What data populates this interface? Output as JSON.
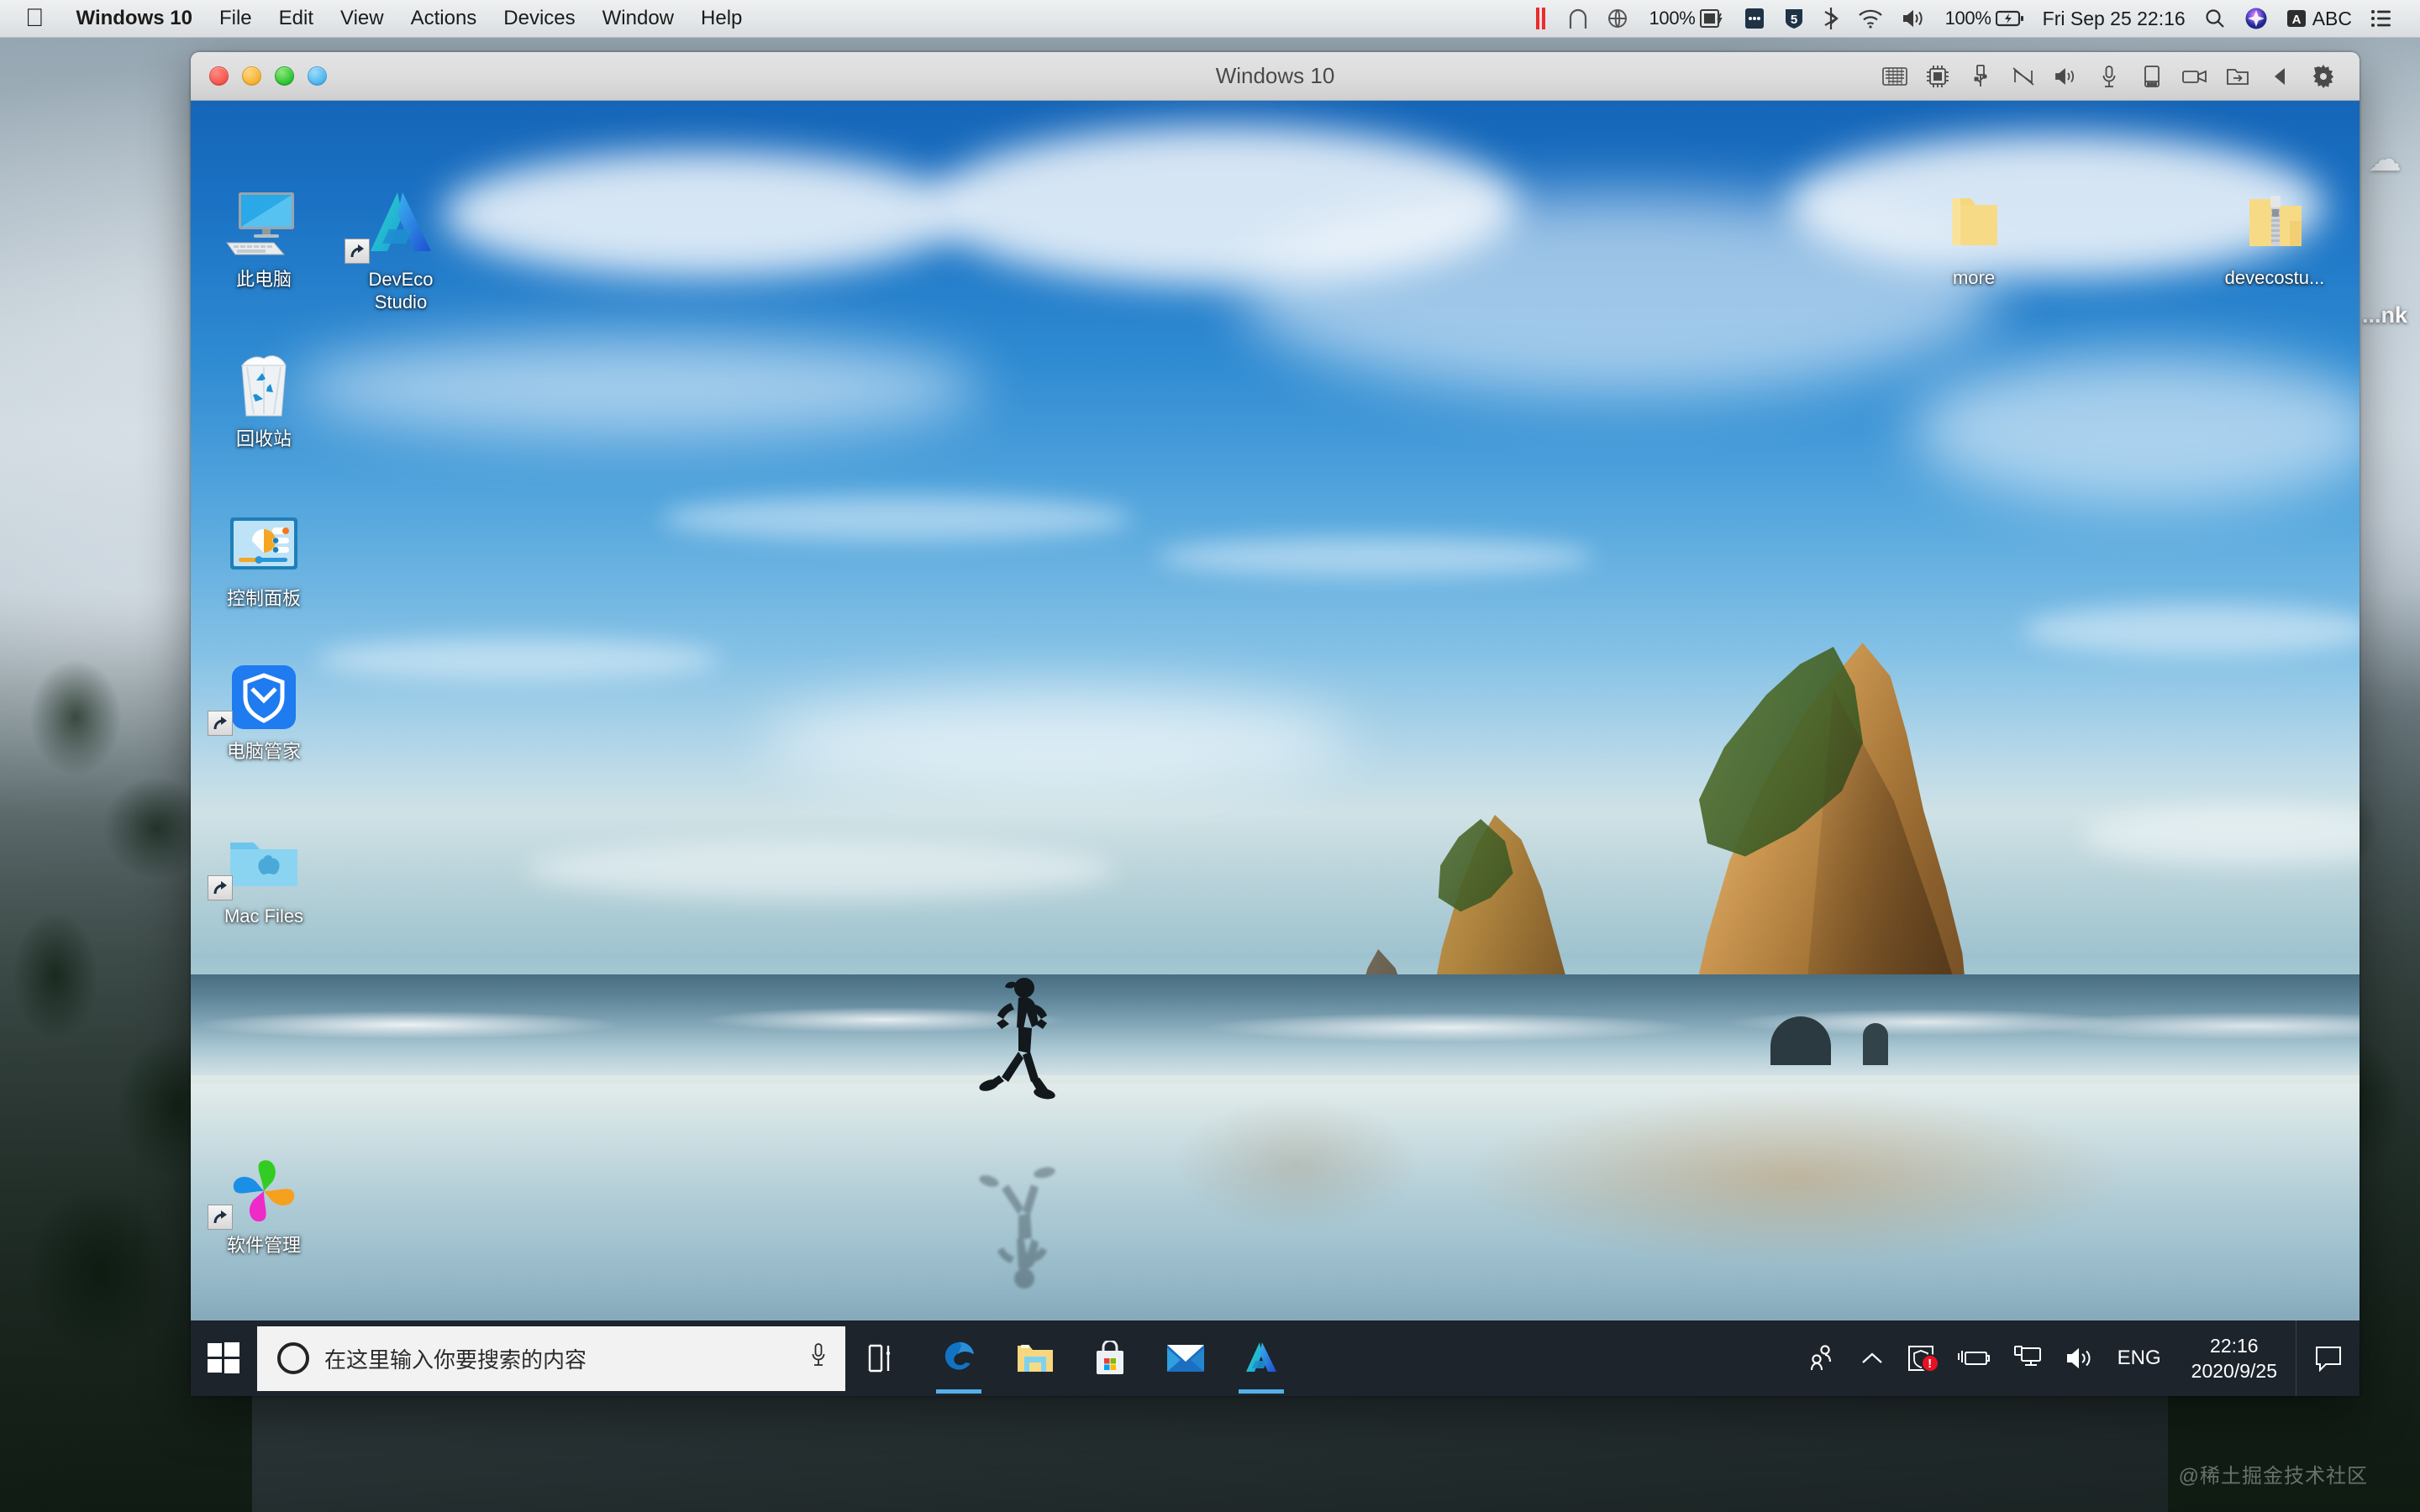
{
  "mac_menubar": {
    "apple_icon": "apple-logo-icon",
    "app_name": "Windows 10",
    "menus": [
      "File",
      "Edit",
      "View",
      "Actions",
      "Devices",
      "Window",
      "Help"
    ],
    "status_items": [
      {
        "name": "pause-bars-icon",
        "label": ""
      },
      {
        "name": "arc-vpn-icon",
        "label": ""
      },
      {
        "name": "globe-shield-icon",
        "label": ""
      },
      {
        "name": "ipad-battery-icon",
        "label": "100%"
      },
      {
        "name": "dots-badge-icon",
        "label": ""
      },
      {
        "name": "shield-s-icon",
        "label": ""
      },
      {
        "name": "bluetooth-icon",
        "label": ""
      },
      {
        "name": "wifi-icon",
        "label": ""
      },
      {
        "name": "volume-icon",
        "label": ""
      },
      {
        "name": "battery-charging-icon",
        "label": "100%"
      },
      {
        "name": "clock",
        "label": "Fri Sep 25  22:16"
      },
      {
        "name": "spotlight-search-icon",
        "label": ""
      },
      {
        "name": "siri-icon",
        "label": ""
      },
      {
        "name": "input-source-icon",
        "label": "ABC"
      },
      {
        "name": "control-center-icon",
        "label": ""
      }
    ]
  },
  "mac_desktop": {
    "edge_icon_label": "...nk"
  },
  "vm_window": {
    "title": "Windows 10",
    "traffic_lights": [
      "close",
      "minimize",
      "maximize",
      "fullscreen"
    ],
    "toolbar_icons": [
      "keyboard-icon",
      "cpu-icon",
      "usb-icon",
      "network-disabled-icon",
      "speaker-icon",
      "microphone-icon",
      "mobile-device-icon",
      "camera-icon",
      "shared-folder-icon",
      "back-arrow-icon",
      "gear-icon"
    ]
  },
  "windows_desktop": {
    "icons": [
      {
        "name": "this-pc",
        "label": "此电脑",
        "icon": "monitor-icon",
        "shortcut": false
      },
      {
        "name": "deveco-studio",
        "label": "DevEco\nStudio",
        "icon": "deveco-icon",
        "shortcut": true
      },
      {
        "name": "recycle-bin",
        "label": "回收站",
        "icon": "recycle-bin-icon",
        "shortcut": false
      },
      {
        "name": "control-panel",
        "label": "控制面板",
        "icon": "control-panel-icon",
        "shortcut": false
      },
      {
        "name": "pc-manager",
        "label": "电脑管家",
        "icon": "shield-blue-icon",
        "shortcut": true
      },
      {
        "name": "mac-files",
        "label": "Mac Files",
        "icon": "apple-folder-icon",
        "shortcut": true
      },
      {
        "name": "software-manager",
        "label": "软件管理",
        "icon": "pinwheel-icon",
        "shortcut": true
      },
      {
        "name": "more-folder",
        "label": "more",
        "icon": "folder-open-icon",
        "shortcut": false
      },
      {
        "name": "devecostudio-zip",
        "label": "devecostu...",
        "icon": "zip-folder-icon",
        "shortcut": false
      }
    ]
  },
  "taskbar": {
    "start_label": "Start",
    "search": {
      "placeholder": "在这里输入你要搜索的内容",
      "value": "",
      "cortana_icon": "cortana-ring-icon",
      "mic_icon": "microphone-icon"
    },
    "pinned_apps": [
      {
        "name": "task-view",
        "label": "Task View",
        "icon": "task-view-icon",
        "active": false
      },
      {
        "name": "microsoft-edge",
        "label": "Microsoft Edge",
        "icon": "edge-icon",
        "active": true
      },
      {
        "name": "file-explorer",
        "label": "File Explorer",
        "icon": "folder-icon",
        "active": false
      },
      {
        "name": "microsoft-store",
        "label": "Microsoft Store",
        "icon": "store-bag-icon",
        "active": false
      },
      {
        "name": "mail",
        "label": "Mail",
        "icon": "envelope-icon",
        "active": false
      },
      {
        "name": "deveco-studio",
        "label": "DevEco Studio",
        "icon": "deveco-icon",
        "active": true
      }
    ],
    "tray": {
      "people_icon": "people-icon",
      "chevron_label": "show-hidden-icons",
      "security_badge": "!",
      "language": "ENG",
      "time": "22:16",
      "date": "2020/9/25",
      "icons": [
        "security-shield-icon",
        "battery-plug-icon",
        "network-icon",
        "volume-icon"
      ],
      "action_center_icon": "speech-bubble-icon"
    }
  },
  "watermark": "@稀土掘金技术社区",
  "colors": {
    "taskbar_bg": "#1d242c",
    "accent_blue": "#54b0e8",
    "alert_red": "#e81123",
    "edge_blue": "#1173c4",
    "search_bg": "#f2f2f2"
  }
}
